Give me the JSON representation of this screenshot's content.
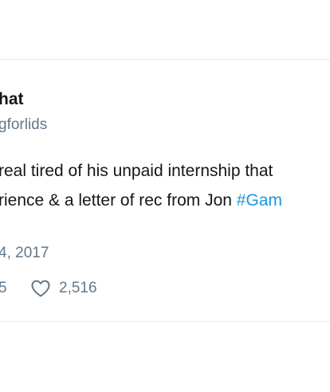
{
  "tweet": {
    "display_name": "hat",
    "handle": "gforlids",
    "text_line_1": "real tired of his unpaid internship that",
    "text_line_2_prefix": "rience & a letter of rec from Jon ",
    "hashtag": "#Gam",
    "timestamp": "4, 2017",
    "retweet_count": "5",
    "like_count": "2,516"
  },
  "colors": {
    "text": "#14171a",
    "secondary": "#657786",
    "hashtag": "#1b95e0",
    "border": "#e6ecf0"
  },
  "icons": {
    "like": "heart-outline-icon"
  }
}
